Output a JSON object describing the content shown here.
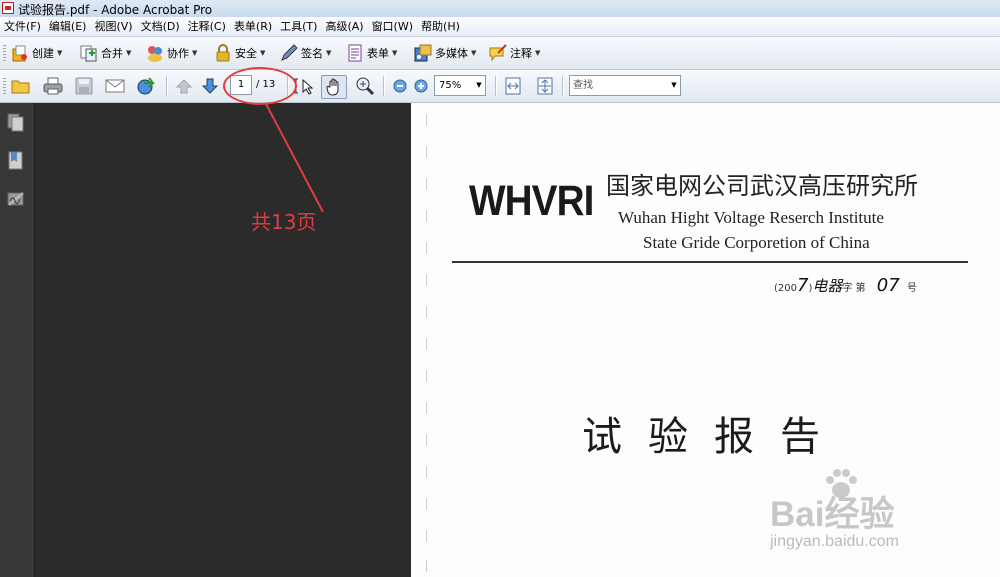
{
  "window": {
    "title": "试验报告.pdf - Adobe Acrobat Pro"
  },
  "menu": [
    "文件(F)",
    "编辑(E)",
    "视图(V)",
    "文档(D)",
    "注释(C)",
    "表单(R)",
    "工具(T)",
    "高级(A)",
    "窗口(W)",
    "帮助(H)"
  ],
  "toolbar1": {
    "create": "创建",
    "combine": "合并",
    "collaborate": "协作",
    "secure": "安全",
    "sign": "签名",
    "forms": "表单",
    "multimedia": "多媒体",
    "comment": "注释"
  },
  "toolbar2": {
    "current_page": "1",
    "total_pages": "/ 13",
    "zoom": "75%",
    "find_placeholder": "查找"
  },
  "document": {
    "logo": "WHVRI",
    "org_cn": "国家电网公司武汉高压研究所",
    "org_en_line1": "Wuhan Hight Voltage Reserch Institute",
    "org_en_line2": "State Gride Corporetion of China",
    "doc_number": {
      "prefix": "(200",
      "year_digit": "7",
      "mid": ")",
      "handwritten_word": "电器",
      "char": "字  第",
      "number": "07",
      "suffix": "号"
    },
    "report_title": "试验报告"
  },
  "annotation": {
    "text": "共13页",
    "color": "#e23d3d"
  },
  "watermark": {
    "brand": "Bai经验",
    "url": "jingyan.baidu.com"
  },
  "colors": {
    "accent": "#e23d3d",
    "background": "#2b2b2b",
    "nav_pane": "#373737"
  }
}
